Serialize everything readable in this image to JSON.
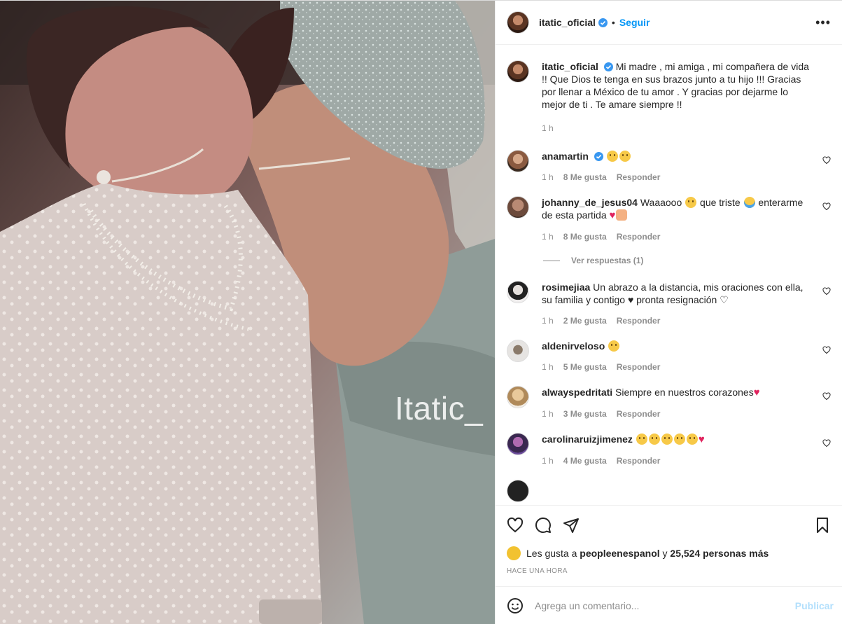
{
  "post": {
    "author": "itatic_oficial",
    "follow_label": "Seguir",
    "more_label": "•••",
    "watermark": "Itatic_",
    "caption": {
      "user": "itatic_oficial",
      "text": "Mi madre , mi amiga , mi compañera de vida !! Que Dios te tenga en sus brazos junto a tu hijo !!! Gracias por llenar a México de tu amor . Y gracias por dejarme lo mejor de ti . Te amare siempre !!",
      "time": "1 h"
    }
  },
  "comments": [
    {
      "user": "anamartin",
      "verified": true,
      "text": "",
      "emojis": [
        "sad",
        "sad"
      ],
      "time": "1 h",
      "likes": "8 Me gusta",
      "reply": "Responder"
    },
    {
      "user": "johanny_de_jesus04",
      "text_a": "Waaaooo",
      "text_b": "que triste",
      "text_c": "enterarme de esta partida",
      "time": "1 h",
      "likes": "8 Me gusta",
      "reply": "Responder",
      "view_replies": "Ver respuestas (1)"
    },
    {
      "user": "rosimejiaa",
      "text": "Un abrazo a la distancia, mis oraciones con ella, su familia y contigo ♥ pronta resignación ♡",
      "time": "1 h",
      "likes": "2 Me gusta",
      "reply": "Responder"
    },
    {
      "user": "aldenirveloso",
      "text": "",
      "time": "1 h",
      "likes": "5 Me gusta",
      "reply": "Responder"
    },
    {
      "user": "alwayspedritati",
      "text": "Siempre en nuestros corazones",
      "time": "1 h",
      "likes": "3 Me gusta",
      "reply": "Responder"
    },
    {
      "user": "carolinaruizjimenez",
      "text": "",
      "time": "1 h",
      "likes": "4 Me gusta",
      "reply": "Responder"
    }
  ],
  "actions": {
    "likes_prefix": "Les gusta a",
    "likes_user": "peopleenespanol",
    "likes_joiner": "y",
    "likes_count": "25,524 personas más",
    "timestamp": "HACE UNA HORA"
  },
  "add_comment": {
    "placeholder": "Agrega un comentario...",
    "publish": "Publicar"
  },
  "colors": {
    "link": "#0095f6",
    "muted": "#8e8e8e",
    "publish_disabled": "#b2dffc"
  }
}
